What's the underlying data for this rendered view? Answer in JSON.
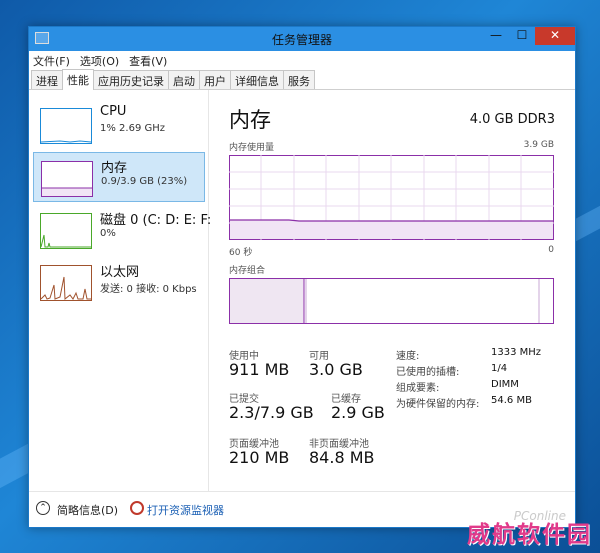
{
  "window": {
    "title": "任务管理器",
    "minimize": "—",
    "maximize": "☐",
    "close": "✕"
  },
  "menu": [
    "文件(F)",
    "选项(O)",
    "查看(V)"
  ],
  "tabs": [
    "进程",
    "性能",
    "应用历史记录",
    "启动",
    "用户",
    "详细信息",
    "服务"
  ],
  "active_tab": "性能",
  "resources": [
    {
      "name": "CPU",
      "value": "1% 2.69 GHz",
      "color": "#1a8ad8"
    },
    {
      "name": "内存",
      "value": "0.9/3.9 GB (23%)",
      "color": "#8b2fa8"
    },
    {
      "name": "磁盘 0 (C: D: E: F:",
      "value": "0%",
      "color": "#4aa82a"
    },
    {
      "name": "以太网",
      "value": "发送: 0 接收: 0 Kbps",
      "color": "#a0522d"
    }
  ],
  "memory": {
    "title": "内存",
    "spec": "4.0 GB DDR3",
    "usage_label": "内存使用量",
    "usage_max": "3.9 GB",
    "time_left": "60 秒",
    "time_right": "0",
    "composition_label": "内存组合",
    "in_use_fraction": 0.23,
    "stats": {
      "in_use_label": "使用中",
      "in_use": "911 MB",
      "available_label": "可用",
      "available": "3.0 GB",
      "committed_label": "已提交",
      "committed": "2.3/7.9 GB",
      "cached_label": "已缓存",
      "cached": "2.9 GB",
      "paged_label": "页面缓冲池",
      "paged": "210 MB",
      "nonpaged_label": "非页面缓冲池",
      "nonpaged": "84.8 MB"
    },
    "details": [
      {
        "label": "速度:",
        "value": "1333 MHz"
      },
      {
        "label": "已使用的插槽:",
        "value": "1/4"
      },
      {
        "label": "组成要素:",
        "value": "DIMM"
      },
      {
        "label": "为硬件保留的内存:",
        "value": "54.6 MB"
      }
    ]
  },
  "bottom": {
    "fewer_details": "简略信息(D)",
    "resource_monitor": "打开资源监视器"
  },
  "watermark": "威航软件园",
  "watermark_small": "PConline",
  "colors": {
    "accent": "#2b8fe3",
    "memory": "#8b2fa8",
    "selected": "#cfe7f9"
  }
}
